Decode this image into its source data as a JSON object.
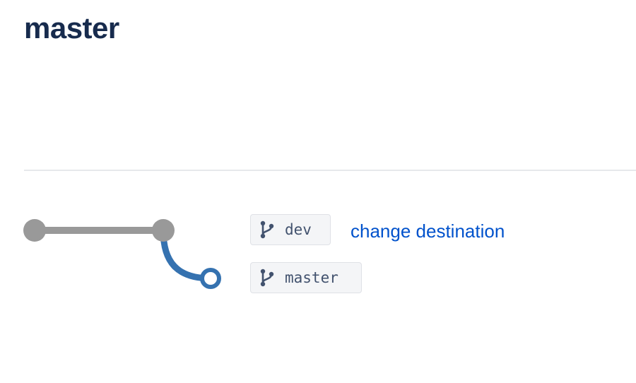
{
  "header": {
    "title": "master"
  },
  "comparison": {
    "source_branch": "dev",
    "destination_branch": "master",
    "change_destination_label": "change destination"
  },
  "icons": {
    "branch": "branch-icon",
    "commit": "commit-node-icon"
  },
  "colors": {
    "title": "#172b4d",
    "source_line": "#999999",
    "destination_line": "#3572b0",
    "link": "#0052cc",
    "chip_bg": "#f4f5f7",
    "chip_border": "#dfe1e6",
    "chip_text": "#42526e"
  }
}
